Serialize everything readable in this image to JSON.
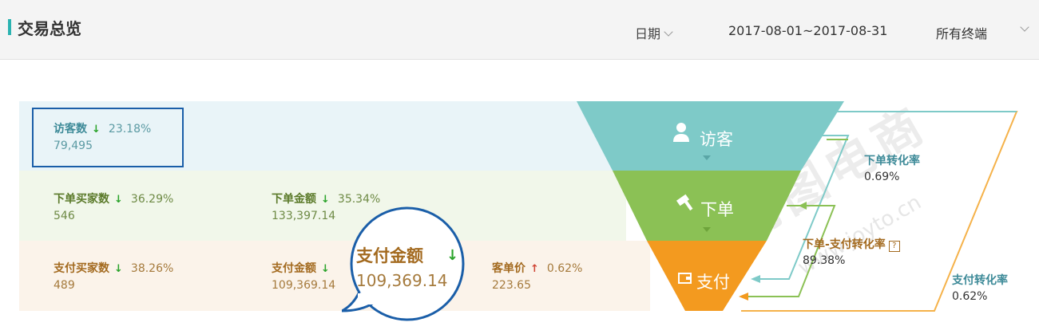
{
  "header": {
    "title": "交易总览",
    "date_label": "日期",
    "date_range": "2017-08-01~2017-08-31",
    "terminal": "所有终端"
  },
  "visitors": {
    "name": "访客数",
    "pct": "23.18%",
    "value": "79,495",
    "trend": "down"
  },
  "orders": {
    "buyers": {
      "name": "下单买家数",
      "pct": "36.29%",
      "value": "546",
      "trend": "down"
    },
    "amount": {
      "name": "下单金额",
      "pct": "35.34%",
      "value": "133,397.14",
      "trend": "down"
    }
  },
  "payment": {
    "buyers": {
      "name": "支付买家数",
      "pct": "38.26%",
      "value": "489",
      "trend": "down"
    },
    "amount": {
      "name": "支付金额",
      "value": "109,369.14",
      "trend": "down"
    },
    "highlight": {
      "name": "支付金额",
      "value": "109,369.14",
      "trend": "down"
    },
    "unit_price": {
      "name": "客单价",
      "pct": "0.62%",
      "value": "223.65",
      "trend": "up"
    }
  },
  "funnel": {
    "stage1": "访客",
    "stage2": "下单",
    "stage3": "支付",
    "rate_order": {
      "name": "下单转化率",
      "value": "0.69%"
    },
    "rate_order_pay": {
      "name": "下单-支付转化率",
      "value": "89.38%"
    },
    "rate_pay": {
      "name": "支付转化率",
      "value": "0.62%"
    },
    "colors": {
      "visitor": "#7ecac8",
      "order": "#8bc155",
      "pay": "#f39a1f"
    }
  },
  "watermark": {
    "brand": "简图电商",
    "url": "www.joyto.cn"
  }
}
